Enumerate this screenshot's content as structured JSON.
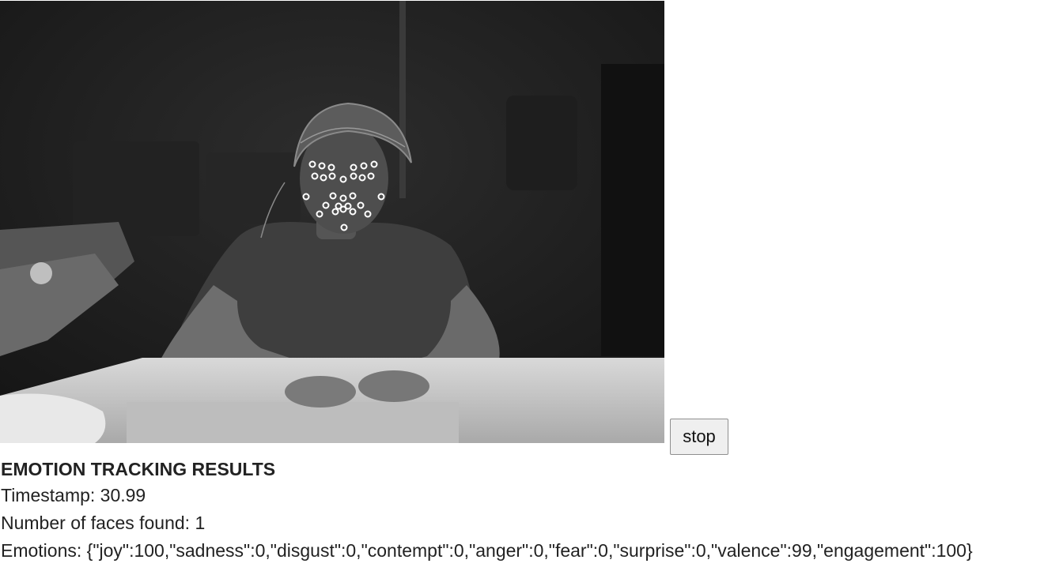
{
  "video": {
    "description_icon": "webcam-feed"
  },
  "controls": {
    "stop_label": "stop"
  },
  "results": {
    "heading": "EMOTION TRACKING RESULTS",
    "timestamp_label": "Timestamp: ",
    "timestamp_value": "30.99",
    "faces_label": "Number of faces found: ",
    "faces_value": "1",
    "emotions_label": "Emotions: ",
    "emotions_value": "{\"joy\":100,\"sadness\":0,\"disgust\":0,\"contempt\":0,\"anger\":0,\"fear\":0,\"surprise\":0,\"valence\":99,\"engagement\":100}"
  },
  "colors": {
    "landmark": "#ffffff",
    "button_bg": "#efefef",
    "text": "#222222"
  }
}
